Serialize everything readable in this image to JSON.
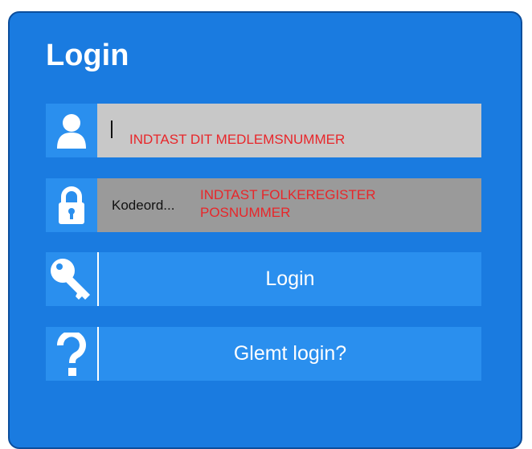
{
  "login_form": {
    "title": "Login",
    "username": {
      "value": "",
      "annotation": "INDTAST DIT MEDLEMSNUMMER",
      "icon": "user-icon"
    },
    "password": {
      "placeholder": "Kodeord...",
      "annotation": "INDTAST FOLKEREGISTER POSNUMMER",
      "icon": "lock-icon"
    },
    "login_button": {
      "label": "Login",
      "icon": "key-icon"
    },
    "forgot_button": {
      "label": "Glemt login?",
      "icon": "question-icon"
    }
  },
  "colors": {
    "panel": "#1a7be0",
    "panel_border": "#0c4e9c",
    "row_blue": "#2a8fee",
    "username_field": "#c8c8c8",
    "password_field": "#9a9a9a",
    "annotation": "#e8262a"
  }
}
